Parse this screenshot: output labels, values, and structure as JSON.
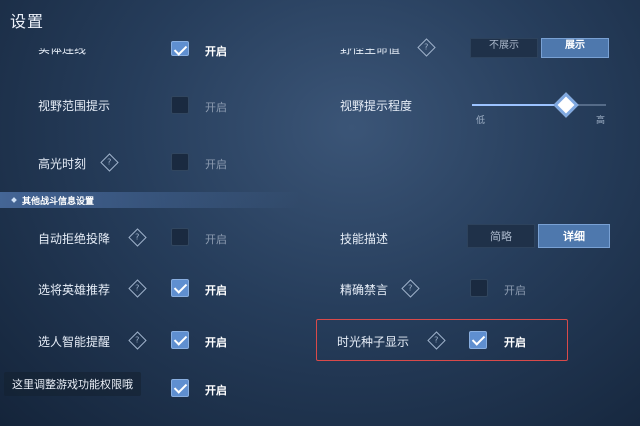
{
  "title": "设置",
  "top_partial": {
    "left_label": "实体连线",
    "left_checkbox": {
      "checked": true,
      "label": "开启"
    },
    "right_label": "野怪生命值",
    "right_options": [
      "不展示",
      "展示"
    ],
    "right_selected": 1
  },
  "vision_range": {
    "label": "视野范围提示",
    "checkbox": {
      "checked": false,
      "label": "开启"
    }
  },
  "vision_degree": {
    "label": "视野提示程度",
    "slider_low": "低",
    "slider_high": "高",
    "value": 0.7
  },
  "highlight_moment": {
    "label": "高光时刻",
    "info_icon": "info-diamond-icon",
    "checkbox": {
      "checked": false,
      "label": "开启"
    }
  },
  "section_title": "其他战斗信息设置",
  "auto_reject": {
    "label": "自动拒绝投降",
    "info_icon": "info-diamond-icon",
    "checkbox": {
      "checked": false,
      "label": "开启"
    }
  },
  "skill_desc": {
    "label": "技能描述",
    "options": [
      "简略",
      "详细"
    ],
    "selected": 1
  },
  "hero_recommend": {
    "label": "选将英雄推荐",
    "info_icon": "info-diamond-icon",
    "checkbox": {
      "checked": true,
      "label": "开启"
    }
  },
  "precise_mute": {
    "label": "精确禁言",
    "info_icon": "info-diamond-icon",
    "checkbox": {
      "checked": false,
      "label": "开启"
    }
  },
  "smart_reminder": {
    "label": "选人智能提醒",
    "info_icon": "info-diamond-icon",
    "checkbox": {
      "checked": true,
      "label": "开启"
    }
  },
  "time_seed": {
    "label": "时光种子显示",
    "info_icon": "info-diamond-icon",
    "checkbox": {
      "checked": true,
      "label": "开启"
    }
  },
  "bottom_row": {
    "tooltip": "这里调整游戏功能权限哦",
    "checkbox": {
      "checked": true,
      "label": "开启"
    }
  },
  "colors": {
    "highlight_box": "#d94a4a",
    "accent": "#5f8fd0",
    "background": "#263d5b"
  }
}
